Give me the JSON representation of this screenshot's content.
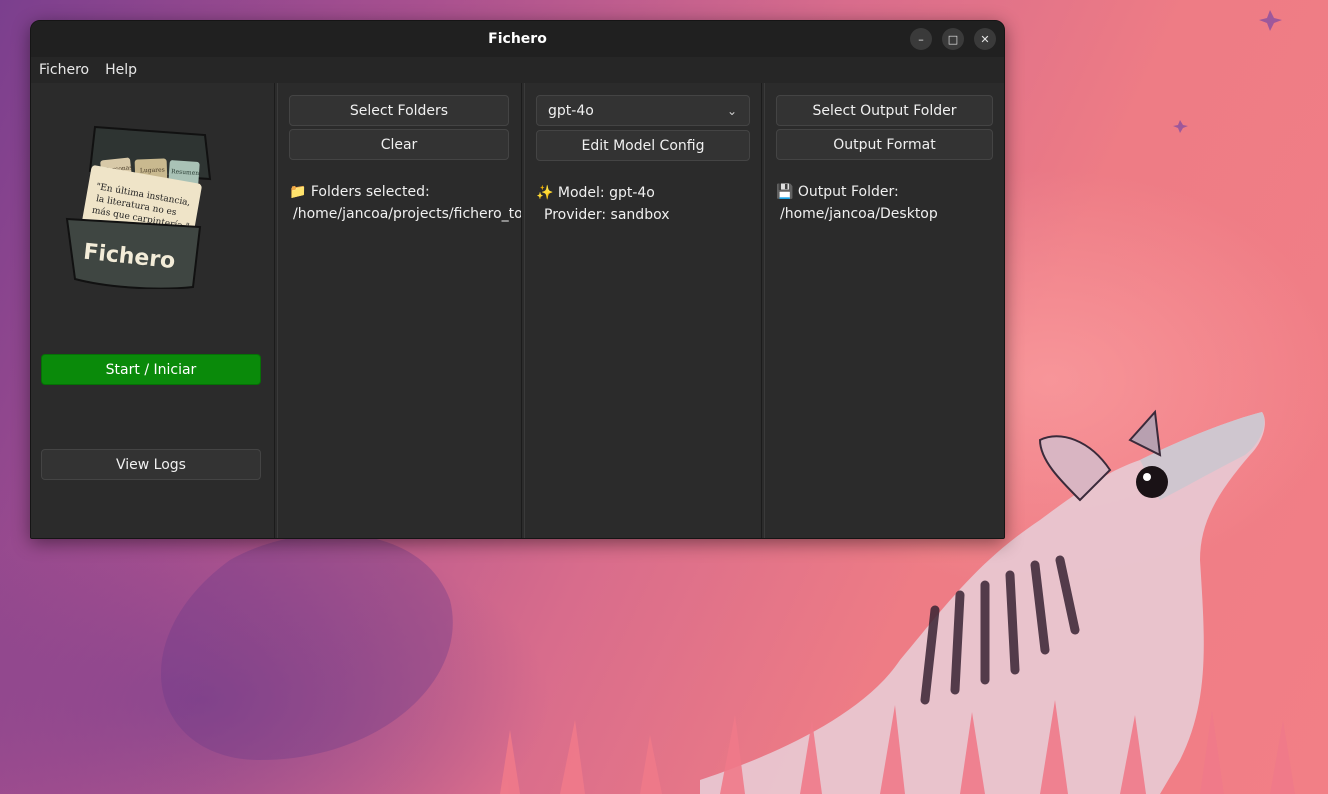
{
  "window": {
    "title": "Fichero"
  },
  "window_controls": {
    "minimize": "–",
    "maximize": "□",
    "close": "✕"
  },
  "menu": {
    "items": [
      "Fichero",
      "Help"
    ]
  },
  "left_panel": {
    "logo": {
      "brand": "Fichero",
      "quote_line1": "\"En última instancia,",
      "quote_line2": "la literatura no es",
      "quote_line3": "más que carpintería.\"",
      "tab1": "Personas",
      "tab2": "Lugares",
      "tab3": "Resumen"
    },
    "start_label": "Start / Iniciar",
    "logs_label": "View Logs"
  },
  "folders_panel": {
    "select_label": "Select Folders",
    "clear_label": "Clear",
    "selected_header": "📁 Folders selected:",
    "selected_path": "/home/jancoa/projects/fichero_to"
  },
  "model_panel": {
    "selected_model": "gpt-4o",
    "edit_label": "Edit Model Config",
    "model_line": "✨ Model: gpt-4o",
    "provider_line": "Provider: sandbox"
  },
  "output_panel": {
    "select_label": "Select Output Folder",
    "format_label": "Output Format",
    "folder_header": "💾 Output Folder:",
    "folder_path": "/home/jancoa/Desktop"
  },
  "colors": {
    "accent_green": "#0a8a0a",
    "window_bg": "#2b2b2b",
    "titlebar_bg": "#202020"
  }
}
